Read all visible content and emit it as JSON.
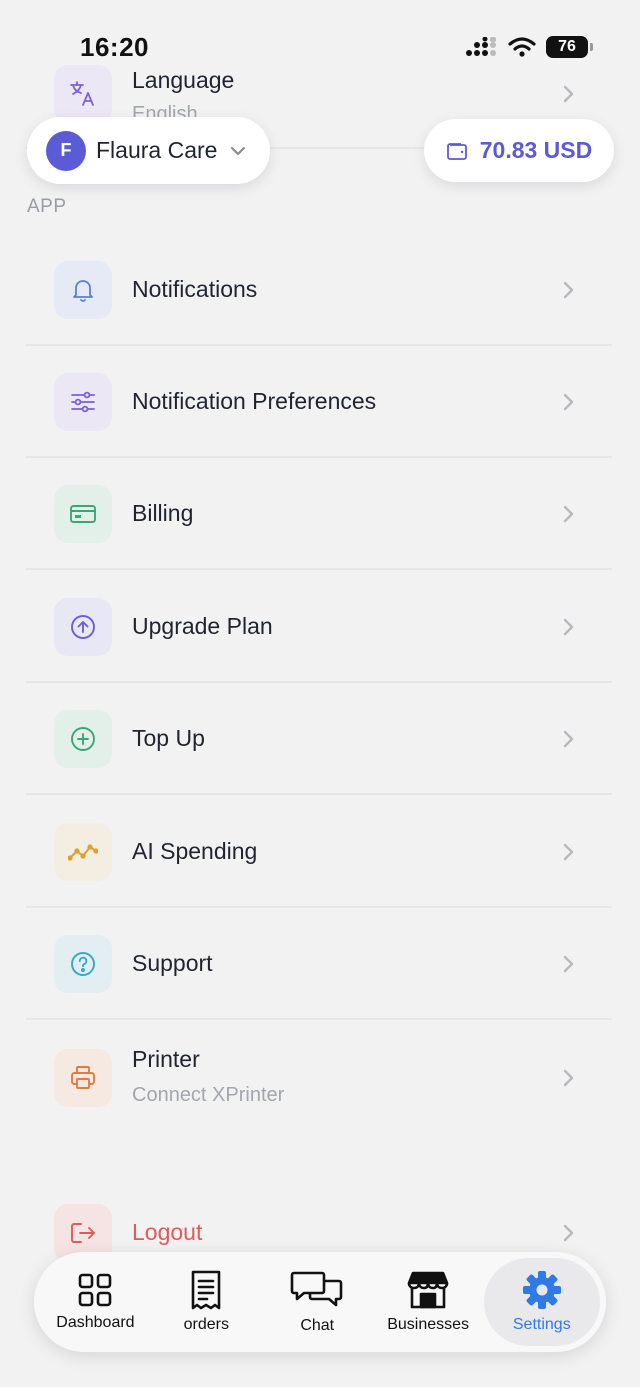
{
  "status_bar": {
    "time": "16:20",
    "battery": "76"
  },
  "header": {
    "business": {
      "initial": "F",
      "name": "Flaura Care"
    },
    "wallet": {
      "amount": "70.83 USD"
    }
  },
  "language_row": {
    "label": "Language",
    "value": "English"
  },
  "section_app": "APP",
  "rows": [
    {
      "label": "Notifications",
      "icon": "bell-icon",
      "color": "#5b7fd6",
      "bg": "#e6e9f6"
    },
    {
      "label": "Notification Preferences",
      "icon": "sliders-icon",
      "color": "#7f5fd6",
      "bg": "#ebe7f5"
    },
    {
      "label": "Billing",
      "icon": "credit-card-icon",
      "color": "#3aa676",
      "bg": "#e3efe9"
    },
    {
      "label": "Upgrade Plan",
      "icon": "arrow-up-circle-icon",
      "color": "#6a5fd6",
      "bg": "#e8e7f5"
    },
    {
      "label": "Top Up",
      "icon": "plus-circle-icon",
      "color": "#3aa676",
      "bg": "#e3efe9"
    },
    {
      "label": "AI Spending",
      "icon": "trend-line-icon",
      "color": "#e0a030",
      "bg": "#f4ede2"
    },
    {
      "label": "Support",
      "icon": "help-circle-icon",
      "color": "#35a8c7",
      "bg": "#e2eef2"
    },
    {
      "label": "Printer",
      "sub": "Connect XPrinter",
      "icon": "printer-icon",
      "color": "#e27a44",
      "bg": "#f5e9e2"
    }
  ],
  "logout": {
    "label": "Logout",
    "color": "#e05a5a"
  },
  "tabs": [
    {
      "label": "Dashboard",
      "icon": "grid-icon"
    },
    {
      "label": "orders",
      "icon": "receipt-icon"
    },
    {
      "label": "Chat",
      "icon": "chat-icon"
    },
    {
      "label": "Businesses",
      "icon": "store-icon"
    },
    {
      "label": "Settings",
      "icon": "gear-icon",
      "active": true
    }
  ],
  "colors": {
    "accent": "#5b5bd6",
    "active_tab": "#2f7ae5",
    "logout": "#e05a5a"
  }
}
